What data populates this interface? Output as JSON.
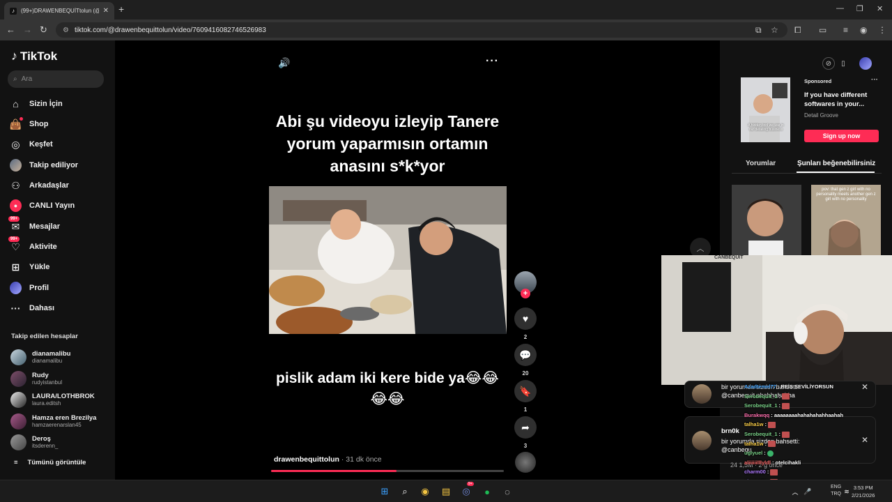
{
  "browser": {
    "tab_title": "(99+)DRAWENBEQUİTtolun (@",
    "tab_favicon": "tiktok-icon",
    "url": "tiktok.com/@drawenbequittolun/video/7609416082746526983"
  },
  "sidebar": {
    "logo": "TikTok",
    "search_placeholder": "Ara",
    "items": [
      {
        "label": "Sizin İçin",
        "icon": "home-icon"
      },
      {
        "label": "Shop",
        "icon": "shop-bag-icon"
      },
      {
        "label": "Keşfet",
        "icon": "compass-icon"
      },
      {
        "label": "Takip ediliyor",
        "icon": "avatar-icon"
      },
      {
        "label": "Arkadaşlar",
        "icon": "friends-icon"
      },
      {
        "label": "CANLI Yayın",
        "icon": "live-icon"
      },
      {
        "label": "Mesajlar",
        "icon": "messages-icon",
        "badge": "99+"
      },
      {
        "label": "Aktivite",
        "icon": "activity-icon",
        "badge": "99+"
      },
      {
        "label": "Yükle",
        "icon": "upload-icon"
      },
      {
        "label": "Profil",
        "icon": "profile-icon"
      },
      {
        "label": "Dahası",
        "icon": "more-icon"
      }
    ],
    "following_title": "Takip edilen hesaplar",
    "following": [
      {
        "name": "dianamalibu",
        "handle": "dianamalibu"
      },
      {
        "name": "Rudy",
        "handle": "rudyistanbul"
      },
      {
        "name": "LAURA/LOTHBROK",
        "handle": "laura.editsh"
      },
      {
        "name": "Hamza eren Brezilya",
        "handle": "hamzaerenarslan45"
      },
      {
        "name": "Deroş",
        "handle": "itsderenn_"
      }
    ],
    "see_all": "Tümünü görüntüle"
  },
  "video": {
    "caption_top": "Abi şu videoyu izleyip Tanere yorum yaparmısın ortamın anasını s*k*yor",
    "caption_bottom": "pislik adam iki kere bide ya😂😂😂😂",
    "author": "drawenbequittolun",
    "time": "· 31 dk önce",
    "progress": 0.54
  },
  "actions": {
    "likes": "2",
    "comments": "20",
    "saves": "1",
    "shares": "3"
  },
  "right_panel": {
    "ad": {
      "sponsored": "Sponsored",
      "title": "If you have different softwares in your...",
      "brand": "Detail Groove",
      "cta": "Sign up now",
      "thumb_text": "A hidden tool we use in our detailing business"
    },
    "tabs": [
      "Yorumlar",
      "Şunları beğenebilirsiniz"
    ],
    "active_tab": 1,
    "suggestion_2_text": "pov: that gen z girl with no personality meets another gen z girl with no personality"
  },
  "overlay": {
    "webcam_label": "CANBEQUİT",
    "notif1": {
      "line1": "bir yorumda sizden bahsetti:",
      "line2": "@canbequit ahahhahahha"
    },
    "notif2": {
      "name": "brn0k",
      "line1": "bir yorumda sizden bahsetti:",
      "line2": "@canbequ"
    },
    "views": "24 1,5M · 2 g önce",
    "chat": [
      {
        "user": "Azadtemel77",
        "msg": ": REİS SEVİLİYORSUN",
        "color": "#4aa8ff"
      },
      {
        "user": "Serobequit_1",
        "msg": ":",
        "color": "#7bd389",
        "emote": true
      },
      {
        "user": "Serobequit_1",
        "msg": ":",
        "color": "#7bd389",
        "emote": true
      },
      {
        "user": "Burakwqq",
        "msg": ": aaaaaaaahahahahahhaahah",
        "color": "#ff6fae"
      },
      {
        "user": "talha1w",
        "msg": ":",
        "color": "#ffd24a",
        "emote": true
      },
      {
        "user": "Serobequit_1",
        "msg": ":",
        "color": "#7bd389",
        "emote": true
      },
      {
        "user": "talha1w",
        "msg": ":",
        "color": "#ffd24a",
        "emote": true
      },
      {
        "user": "uglyuel",
        "msg": ":",
        "color": "#7bd389",
        "emote": true
      },
      {
        "user": "aliiiiiilllyldl",
        "msg": ": otelcihakli",
        "color": "#ff6f6f"
      },
      {
        "user": "charm00",
        "msg": ":",
        "color": "#b07bff",
        "emote": true
      },
      {
        "user": "charm00",
        "msg": ":",
        "color": "#b07bff",
        "emote": true
      },
      {
        "user": "Azadtemel77",
        "msg": ": REİS SEVİLİYORSUN",
        "color": "#4aa8ff"
      }
    ]
  },
  "taskbar": {
    "lang": "ENG",
    "lang2": "TRQ",
    "time": "3:53 PM",
    "date": "2/21/2026",
    "discord_badge": "9+"
  }
}
